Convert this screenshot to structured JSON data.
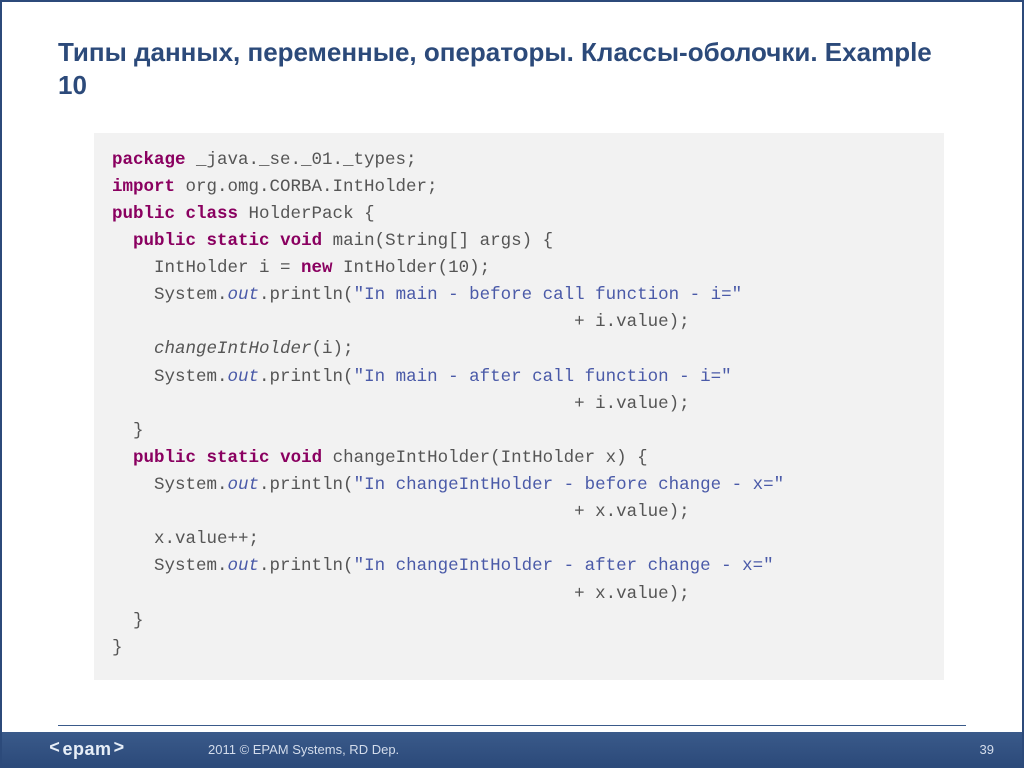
{
  "title": "Типы данных, переменные, операторы. Классы-оболочки. Example 10",
  "code": {
    "l01_kw_package": "package",
    "l01_rest": " _java._se._01._types;",
    "l02_kw_import": "import",
    "l02_rest": " org.omg.CORBA.IntHolder;",
    "l03_kw_public": "public",
    "l03_kw_class": "class",
    "l03_rest": " HolderPack {",
    "l04_kw_public": "public",
    "l04_kw_static": "static",
    "l04_kw_void": "void",
    "l04_rest": " main(String[] args) {",
    "l05a": "    IntHolder i = ",
    "l05_kw_new": "new",
    "l05b": " IntHolder(10);",
    "l06a": "    System.",
    "l06_out": "out",
    "l06b": ".println(",
    "l06_str": "\"In main - before call function - i=\"",
    "l07a": "                                            + i.value);",
    "l08_call": "    changeIntHolder",
    "l08_rest": "(i);",
    "l09a": "    System.",
    "l09_out": "out",
    "l09b": ".println(",
    "l09_str": "\"In main - after call function - i=\"",
    "l10a": "                                            + i.value);",
    "l11": "  }",
    "l12_kw_public": "public",
    "l12_kw_static": "static",
    "l12_kw_void": "void",
    "l12_rest": " changeIntHolder(IntHolder x) {",
    "l13a": "    System.",
    "l13_out": "out",
    "l13b": ".println(",
    "l13_str": "\"In changeIntHolder - before change - x=\"",
    "l14a": "                                            + x.value);",
    "l15": "    x.value++;",
    "l16a": "    System.",
    "l16_out": "out",
    "l16b": ".println(",
    "l16_str": "\"In changeIntHolder - after change - x=\"",
    "l17a": "                                            + x.value);",
    "l18": "  }",
    "l19": "}"
  },
  "footer": {
    "logo_name": "epam",
    "copyright": "2011 © EPAM Systems, RD Dep.",
    "page": "39"
  }
}
